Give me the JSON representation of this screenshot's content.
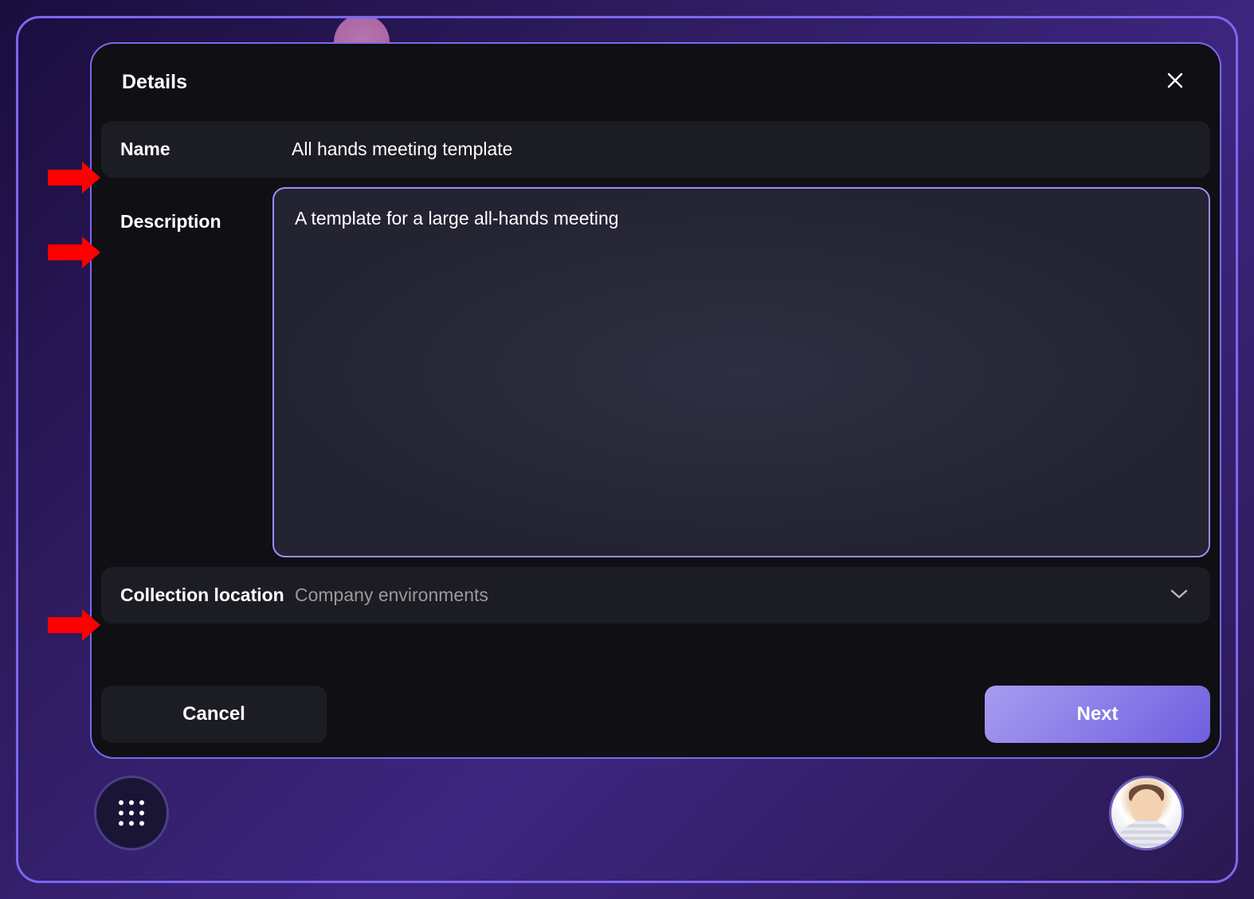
{
  "modal": {
    "title": "Details",
    "fields": {
      "name": {
        "label": "Name",
        "value": "All hands meeting template"
      },
      "description": {
        "label": "Description",
        "value": "A template for a large all-hands meeting"
      },
      "collection": {
        "label": "Collection location",
        "value": "Company environments"
      }
    },
    "buttons": {
      "cancel": "Cancel",
      "next": "Next"
    }
  }
}
